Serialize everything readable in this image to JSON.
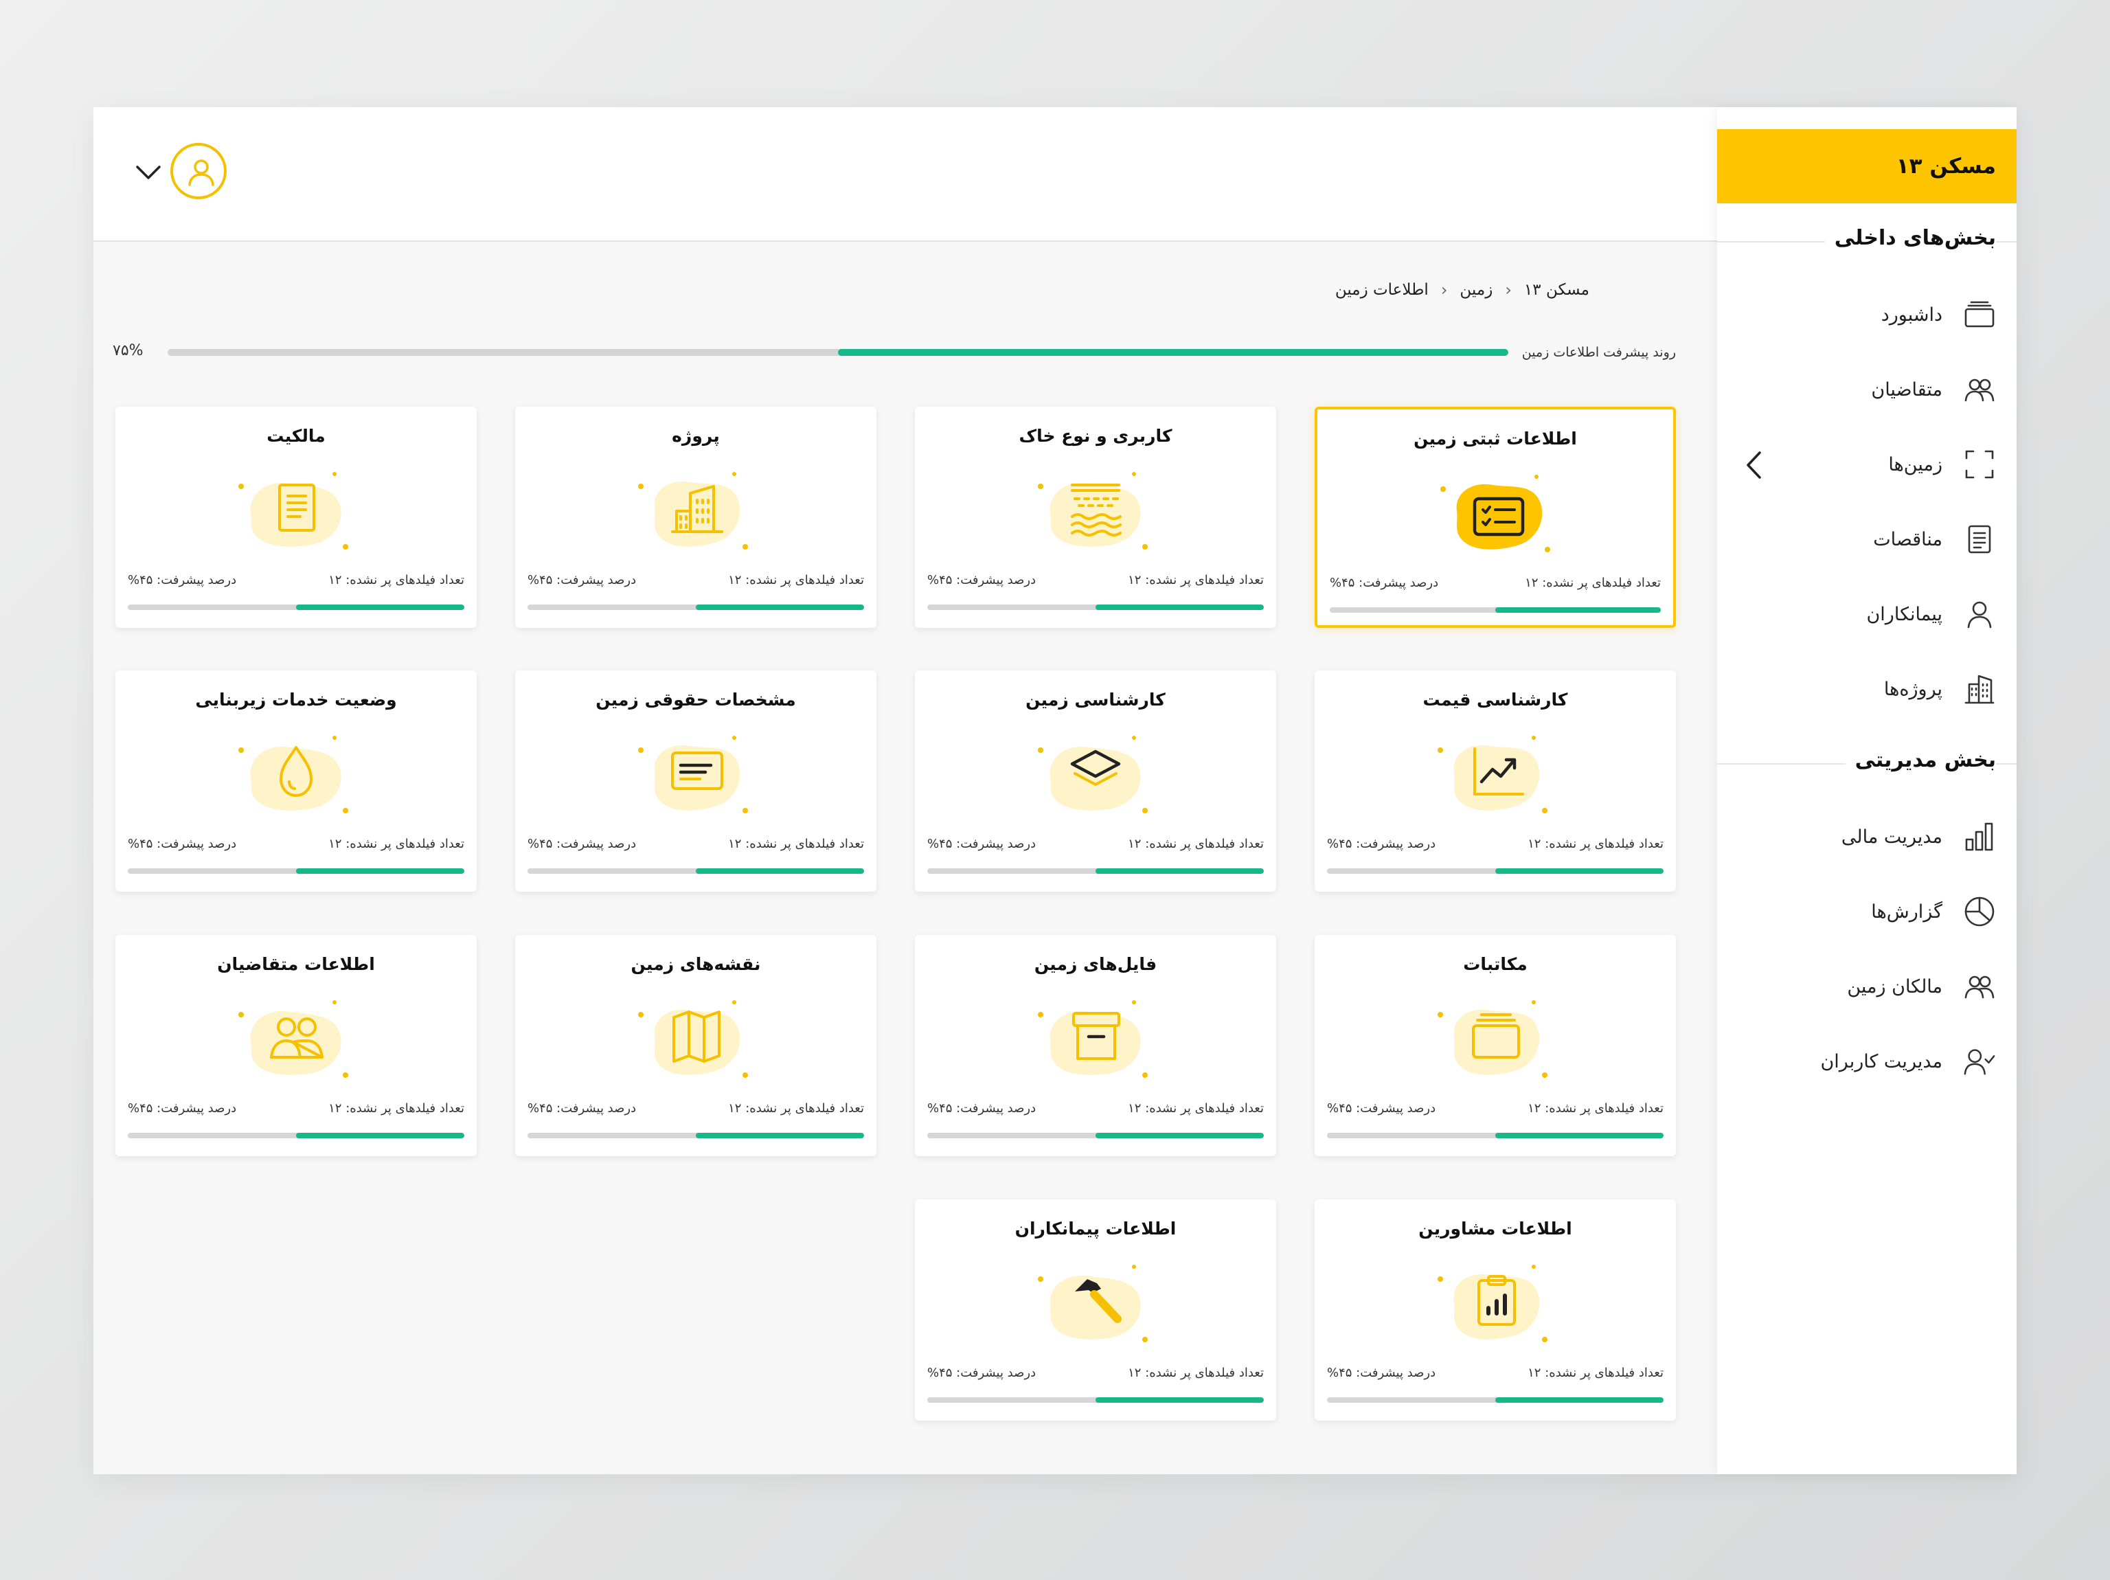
{
  "brand": {
    "title": "مسکن ۱۳"
  },
  "sidebar": {
    "section_internal": "بخش‌های داخلی",
    "section_admin": "بخش مدیریتی",
    "items_internal": [
      {
        "label": "داشبورد",
        "icon": "folder-icon"
      },
      {
        "label": "متقاضیان",
        "icon": "users-icon"
      },
      {
        "label": "زمین‌ها",
        "icon": "frame-icon"
      },
      {
        "label": "مناقصات",
        "icon": "document-icon"
      },
      {
        "label": "پیمانکاران",
        "icon": "user-icon"
      },
      {
        "label": "پروژه‌ها",
        "icon": "building-icon"
      }
    ],
    "items_admin": [
      {
        "label": "مدیریت مالی",
        "icon": "bar-chart-icon"
      },
      {
        "label": "گزارش‌ها",
        "icon": "pie-chart-icon"
      },
      {
        "label": "مالکان زمین",
        "icon": "users-icon"
      },
      {
        "label": "مدیریت کاربران",
        "icon": "user-check-icon"
      }
    ]
  },
  "breadcrumb": [
    "مسکن ۱۳",
    "زمین",
    "اطلاعات زمین"
  ],
  "overall": {
    "label": "روند پیشرفت اطلاعات زمین",
    "percent_text": "۷۵%",
    "percent": 50
  },
  "accent": "#ffc400",
  "progress_color": "#16b88a",
  "cards": [
    {
      "title": "اطلاعات ثبتی زمین",
      "fields": "تعداد فیلدهای پر نشده: ۱۲",
      "progress": "درصد پیشرفت: ۴۵%",
      "percent": 50,
      "icon": "checklist-icon",
      "selected": true
    },
    {
      "title": "کاربری و نوع خاک",
      "fields": "تعداد فیلدهای پر نشده: ۱۲",
      "progress": "درصد پیشرفت: ۴۵%",
      "percent": 50,
      "icon": "soil-layers-icon"
    },
    {
      "title": "پروژه",
      "fields": "تعداد فیلدهای پر نشده: ۱۲",
      "progress": "درصد پیشرفت: ۴۵%",
      "percent": 50,
      "icon": "buildings-icon"
    },
    {
      "title": "مالکیت",
      "fields": "تعداد فیلدهای پر نشده: ۱۲",
      "progress": "درصد پیشرفت: ۴۵%",
      "percent": 50,
      "icon": "deed-document-icon"
    },
    {
      "title": "کارشناسی قیمت",
      "fields": "تعداد فیلدهای پر نشده: ۱۲",
      "progress": "درصد پیشرفت: ۴۵%",
      "percent": 50,
      "icon": "trend-chart-icon"
    },
    {
      "title": "کارشناسی زمین",
      "fields": "تعداد فیلدهای پر نشده: ۱۲",
      "progress": "درصد پیشرفت: ۴۵%",
      "percent": 50,
      "icon": "layers-icon"
    },
    {
      "title": "مشخصات حقوقی زمین",
      "fields": "تعداد فیلدهای پر نشده: ۱۲",
      "progress": "درصد پیشرفت: ۴۵%",
      "percent": 50,
      "icon": "id-card-icon"
    },
    {
      "title": "وضعیت خدمات زیربنایی",
      "fields": "تعداد فیلدهای پر نشده: ۱۲",
      "progress": "درصد پیشرفت: ۴۵%",
      "percent": 50,
      "icon": "water-drop-icon"
    },
    {
      "title": "مکاتبات",
      "fields": "تعداد فیلدهای پر نشده: ۱۲",
      "progress": "درصد پیشرفت: ۴۵%",
      "percent": 50,
      "icon": "folder-icon"
    },
    {
      "title": "فایل‌های زمین",
      "fields": "تعداد فیلدهای پر نشده: ۱۲",
      "progress": "درصد پیشرفت: ۴۵%",
      "percent": 50,
      "icon": "archive-box-icon"
    },
    {
      "title": "نقشه‌های زمین",
      "fields": "تعداد فیلدهای پر نشده: ۱۲",
      "progress": "درصد پیشرفت: ۴۵%",
      "percent": 50,
      "icon": "map-icon"
    },
    {
      "title": "اطلاعات متقاضیان",
      "fields": "تعداد فیلدهای پر نشده: ۱۲",
      "progress": "درصد پیشرفت: ۴۵%",
      "percent": 50,
      "icon": "users-icon"
    },
    {
      "title": "اطلاعات مشاورین",
      "fields": "تعداد فیلدهای پر نشده: ۱۲",
      "progress": "درصد پیشرفت: ۴۵%",
      "percent": 50,
      "icon": "clipboard-chart-icon"
    },
    {
      "title": "اطلاعات پیمانکاران",
      "fields": "تعداد فیلدهای پر نشده: ۱۲",
      "progress": "درصد پیشرفت: ۴۵%",
      "percent": 50,
      "icon": "hammer-icon"
    }
  ]
}
